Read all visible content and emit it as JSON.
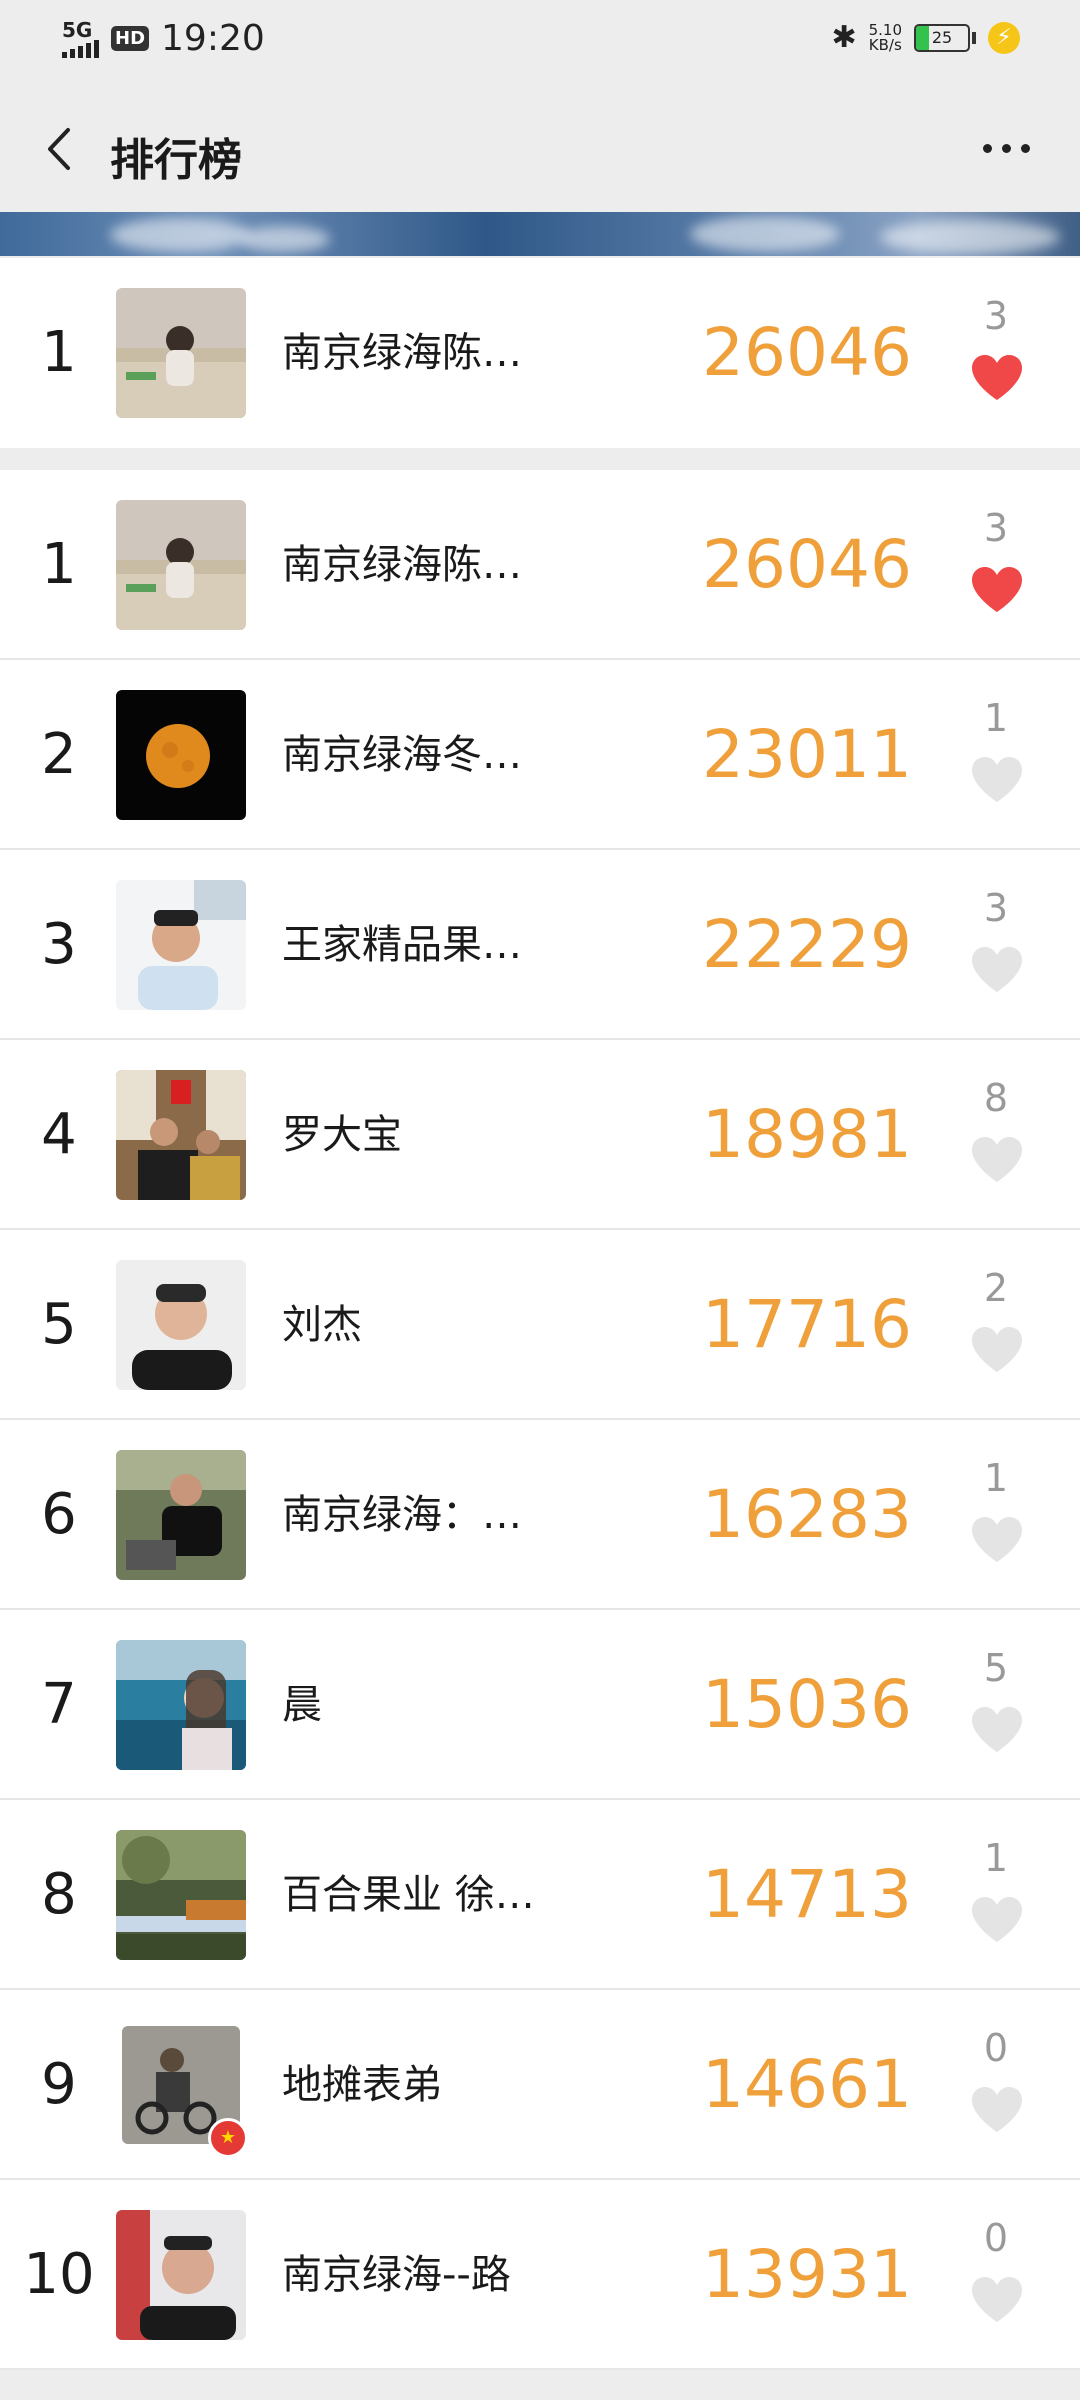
{
  "status_bar": {
    "network": "5G",
    "hd_label": "HD",
    "time": "19:20",
    "speed_value": "5.10",
    "speed_unit": "KB/s",
    "battery_level": "25",
    "battery_fraction": 0.25,
    "icons": [
      "signal-icon",
      "hd-icon",
      "bluetooth-icon",
      "battery-icon",
      "charging-icon"
    ]
  },
  "nav": {
    "title": "排行榜",
    "back_icon": "back-icon",
    "more_icon": "more-icon"
  },
  "colors": {
    "accent": "#f0a03a",
    "liked_heart": "#f04848",
    "unliked_heart": "#e4e4e4",
    "background": "#ededed"
  },
  "my_entry": {
    "rank": "1",
    "name": "南京绿海陈…",
    "steps": "26046",
    "likes": "3",
    "liked": true
  },
  "ranking": [
    {
      "rank": "1",
      "name": "南京绿海陈…",
      "steps": "26046",
      "likes": "3",
      "liked": true
    },
    {
      "rank": "2",
      "name": "南京绿海冬…",
      "steps": "23011",
      "likes": "1",
      "liked": false
    },
    {
      "rank": "3",
      "name": "王家精品果…",
      "steps": "22229",
      "likes": "3",
      "liked": false
    },
    {
      "rank": "4",
      "name": "罗大宝",
      "steps": "18981",
      "likes": "8",
      "liked": false
    },
    {
      "rank": "5",
      "name": "刘杰",
      "steps": "17716",
      "likes": "2",
      "liked": false
    },
    {
      "rank": "6",
      "name": "南京绿海：…",
      "steps": "16283",
      "likes": "1",
      "liked": false
    },
    {
      "rank": "7",
      "name": "晨",
      "steps": "15036",
      "likes": "5",
      "liked": false
    },
    {
      "rank": "8",
      "name": "百合果业 徐…",
      "steps": "14713",
      "likes": "1",
      "liked": false
    },
    {
      "rank": "9",
      "name": "地摊表弟",
      "steps": "14661",
      "likes": "0",
      "liked": false
    },
    {
      "rank": "10",
      "name": "南京绿海--路",
      "steps": "13931",
      "likes": "0",
      "liked": false
    }
  ]
}
